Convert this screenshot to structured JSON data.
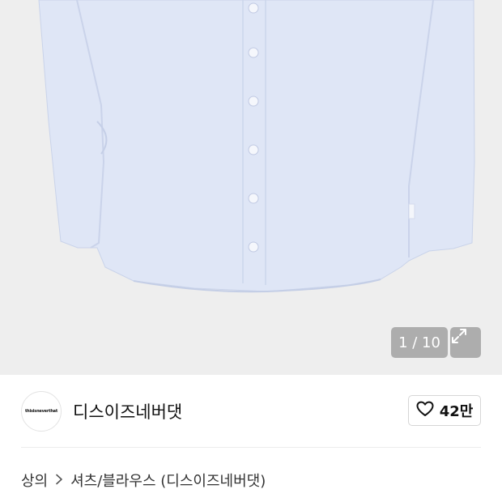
{
  "image_gallery": {
    "current": "1",
    "total": "10",
    "counter_text": "1 / 10",
    "expand_icon": "expand-arrows-icon",
    "shirt_color": "#dfe6f6",
    "background_color": "#eeeeee"
  },
  "brand": {
    "logo_text": "thisisneverthat",
    "name": "디스이즈네버댓"
  },
  "like": {
    "icon": "heart-outline-icon",
    "count": "42만"
  },
  "breadcrumb": {
    "items": [
      "상의",
      "셔츠/블라우스 (디스이즈네버댓)"
    ],
    "separator_icon": "chevron-right-icon"
  }
}
